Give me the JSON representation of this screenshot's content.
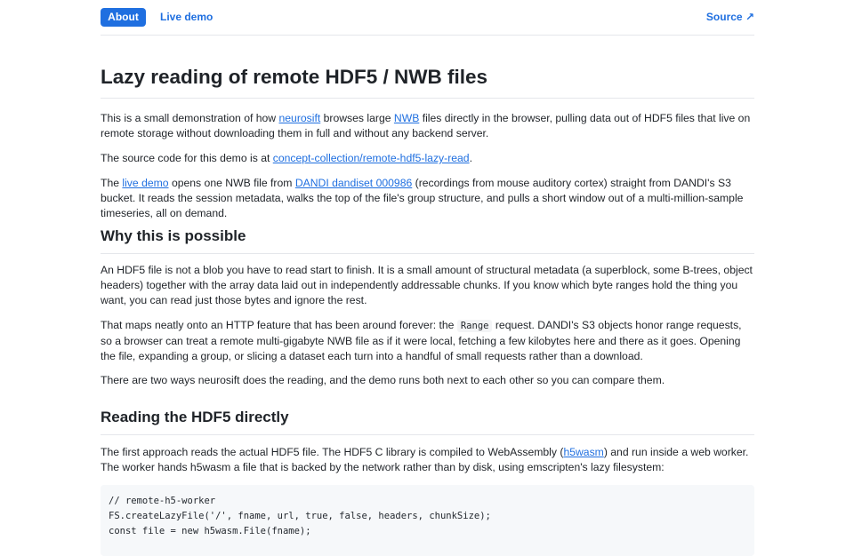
{
  "nav": {
    "about": "About",
    "live_demo": "Live demo",
    "source": "Source ↗"
  },
  "title": "Lazy reading of remote HDF5 / NWB files",
  "intro": {
    "p1": {
      "t1": "This is a small demonstration of how ",
      "link1": "neurosift",
      "t2": " browses large ",
      "link2": "NWB",
      "t3": " files directly in the browser, pulling data out of HDF5 files that live on remote storage without downloading them in full and without any backend server."
    },
    "p2": {
      "t1": "The source code for this demo is at ",
      "link1": "concept-collection/remote-hdf5-lazy-read",
      "t2": "."
    },
    "p3": {
      "t1": "The ",
      "link1": "live demo",
      "t2": " opens one NWB file from ",
      "link2": "DANDI dandiset 000986",
      "t3": " (recordings from mouse auditory cortex) straight from DANDI's S3 bucket. It reads the session metadata, walks the top of the file's group structure, and pulls a short window out of a multi-million-sample timeseries, all on demand."
    }
  },
  "section_why": {
    "heading": "Why this is possible",
    "p1": "An HDF5 file is not a blob you have to read start to finish. It is a small amount of structural metadata (a superblock, some B-trees, object headers) together with the array data laid out in independently addressable chunks. If you know which byte ranges hold the thing you want, you can read just those bytes and ignore the rest.",
    "p2": {
      "t1": "That maps neatly onto an HTTP feature that has been around forever: the ",
      "code": "Range",
      "t2": " request. DANDI's S3 objects honor range requests, so a browser can treat a remote multi-gigabyte NWB file as if it were local, fetching a few kilobytes here and there as it goes. Opening the file, expanding a group, or slicing a dataset each turn into a handful of small requests rather than a download."
    },
    "p3": "There are two ways neurosift does the reading, and the demo runs both next to each other so you can compare them."
  },
  "section_direct": {
    "heading": "Reading the HDF5 directly",
    "p1": {
      "t1": "The first approach reads the actual HDF5 file. The HDF5 C library is compiled to WebAssembly (",
      "link1": "h5wasm",
      "t2": ") and run inside a web worker. The worker hands h5wasm a file that is backed by the network rather than by disk, using emscripten's lazy filesystem:"
    },
    "code": [
      "// remote-h5-worker",
      "FS.createLazyFile('/', fname, url, true, false, headers, chunkSize);",
      "const file = new h5wasm.File(fname);"
    ]
  }
}
